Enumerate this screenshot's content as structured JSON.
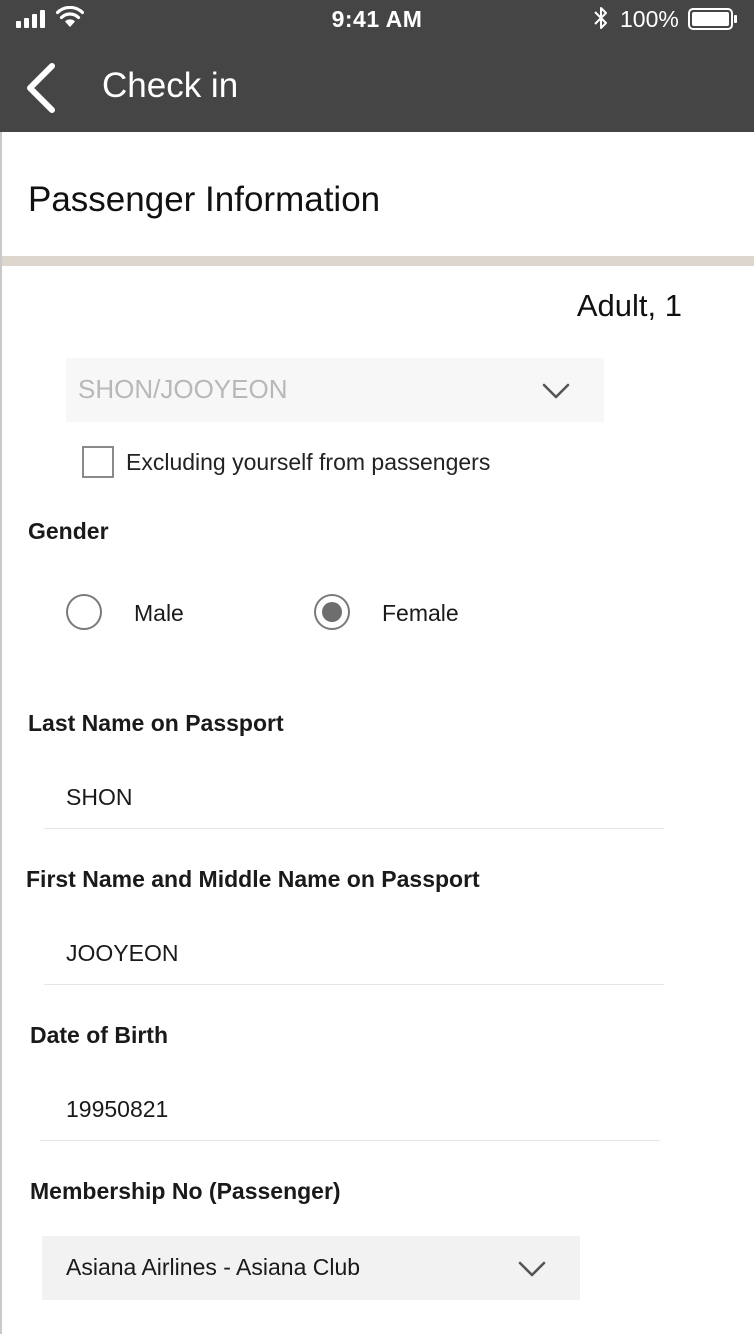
{
  "status_bar": {
    "time": "9:41 AM",
    "battery_percent": "100%",
    "icons": [
      "signal-icon",
      "wifi-icon",
      "bluetooth-icon",
      "battery-icon"
    ]
  },
  "header": {
    "title": "Check in",
    "back_icon": "chevron-left-icon",
    "background_color": "#454545"
  },
  "section": {
    "title": "Passenger Information",
    "divider_color": "#ddd6cf"
  },
  "passenger": {
    "type_label": "Adult, 1",
    "selected": "SHON/JOOYEON",
    "exclude_label": "Excluding yourself from passengers",
    "exclude_checked": false
  },
  "gender": {
    "label": "Gender",
    "options": [
      "Male",
      "Female"
    ],
    "selected": "Female"
  },
  "last_name": {
    "label": "Last Name on Passport",
    "value": "SHON"
  },
  "first_name": {
    "label": "First Name and Middle Name on Passport",
    "value": "JOOYEON"
  },
  "dob": {
    "label": "Date of Birth",
    "value": "19950821"
  },
  "membership": {
    "label": "Membership No (Passenger)",
    "selected": "Asiana Airlines - Asiana Club"
  }
}
